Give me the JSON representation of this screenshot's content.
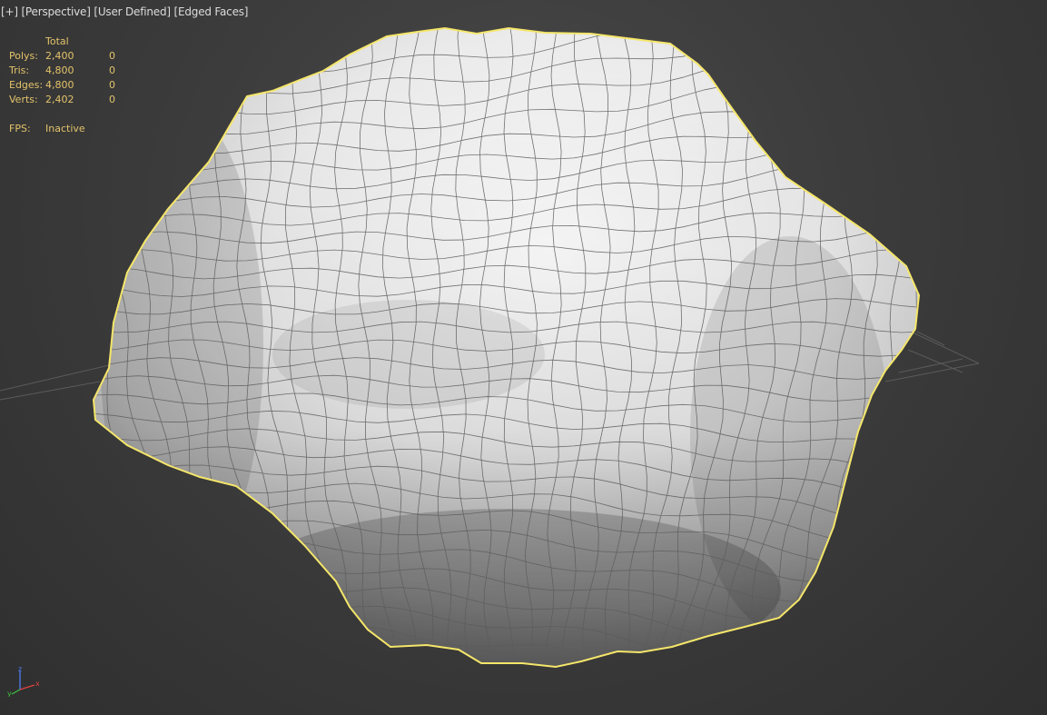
{
  "viewport": {
    "labels": [
      "[+]",
      "[Perspective]",
      "[User Defined]",
      "[Edged Faces]"
    ],
    "background_color": "#3d3d3d",
    "selection_color": "#f5e66a"
  },
  "stats": {
    "header": "Total",
    "rows": [
      {
        "label": "Polys:",
        "total": "2,400",
        "selected": "0"
      },
      {
        "label": "Tris:",
        "total": "4,800",
        "selected": "0"
      },
      {
        "label": "Edges:",
        "total": "4,800",
        "selected": "0"
      },
      {
        "label": "Verts:",
        "total": "2,402",
        "selected": "0"
      }
    ],
    "fps_label": "FPS:",
    "fps_value": "Inactive",
    "text_color": "#e3c36a"
  },
  "axis_gizmo": {
    "x": "x",
    "y": "y",
    "z": "z",
    "x_color": "#e04040",
    "y_color": "#40c040",
    "z_color": "#5080ff"
  }
}
